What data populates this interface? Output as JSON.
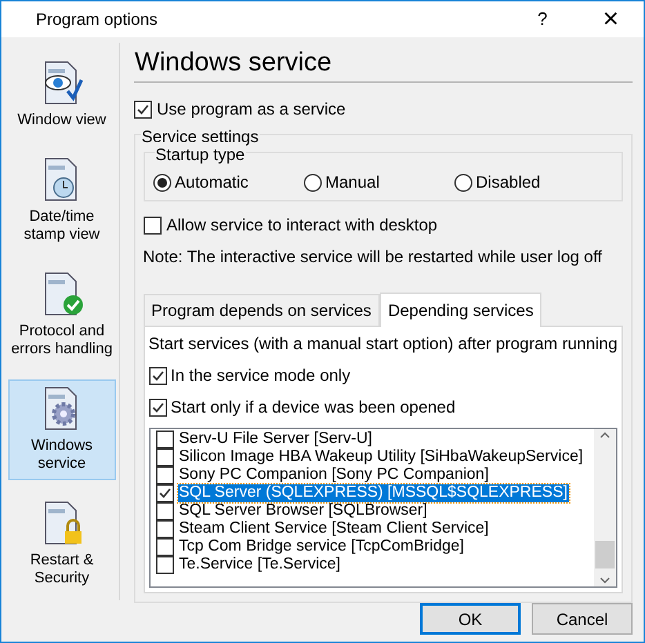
{
  "window": {
    "title": "Program options",
    "help": "?",
    "close": "×"
  },
  "sidebar": {
    "items": [
      {
        "label": "Window view",
        "kind": "eye",
        "selected": false
      },
      {
        "label": "Date/time stamp view",
        "kind": "clock",
        "selected": false
      },
      {
        "label": "Protocol and errors handling",
        "kind": "check",
        "selected": false
      },
      {
        "label": "Windows service",
        "kind": "gear",
        "selected": true
      },
      {
        "label": "Restart & Security",
        "kind": "lock",
        "selected": false
      }
    ]
  },
  "heading": "Windows service",
  "use_service": {
    "label": "Use program as a service",
    "checked": true
  },
  "service_settings": {
    "title": "Service settings",
    "startup_type": {
      "title": "Startup type",
      "options": [
        {
          "label": "Automatic",
          "selected": true
        },
        {
          "label": "Manual",
          "selected": false
        },
        {
          "label": "Disabled",
          "selected": false
        }
      ]
    },
    "interact": {
      "label": "Allow service to interact with desktop",
      "checked": false
    },
    "note": "Note: The interactive service will be restarted while user log off"
  },
  "tabs": [
    {
      "label": "Program depends on services",
      "selected": false
    },
    {
      "label": "Depending services",
      "selected": true
    }
  ],
  "tab_panel": {
    "description": "Start services (with a manual start option) after program running",
    "options": [
      {
        "label": "In the service mode only",
        "checked": true
      },
      {
        "label": "Start only if a device was been opened",
        "checked": true
      }
    ],
    "services": [
      {
        "label": "Serv-U File Server [Serv-U]",
        "checked": false,
        "selected": false
      },
      {
        "label": "Silicon Image HBA Wakeup Utility [SiHbaWakeupService]",
        "checked": false,
        "selected": false
      },
      {
        "label": "Sony PC Companion [Sony PC Companion]",
        "checked": false,
        "selected": false
      },
      {
        "label": "SQL Server (SQLEXPRESS) [MSSQL$SQLEXPRESS]",
        "checked": true,
        "selected": true
      },
      {
        "label": "SQL Server Browser [SQLBrowser]",
        "checked": false,
        "selected": false
      },
      {
        "label": "Steam Client Service [Steam Client Service]",
        "checked": false,
        "selected": false
      },
      {
        "label": "Tcp Com Bridge service [TcpComBridge]",
        "checked": false,
        "selected": false
      },
      {
        "label": "Te.Service [Te.Service]",
        "checked": false,
        "selected": false
      }
    ]
  },
  "buttons": [
    {
      "label": "OK",
      "kind": "default"
    },
    {
      "label": "Cancel",
      "kind": "normal"
    }
  ]
}
